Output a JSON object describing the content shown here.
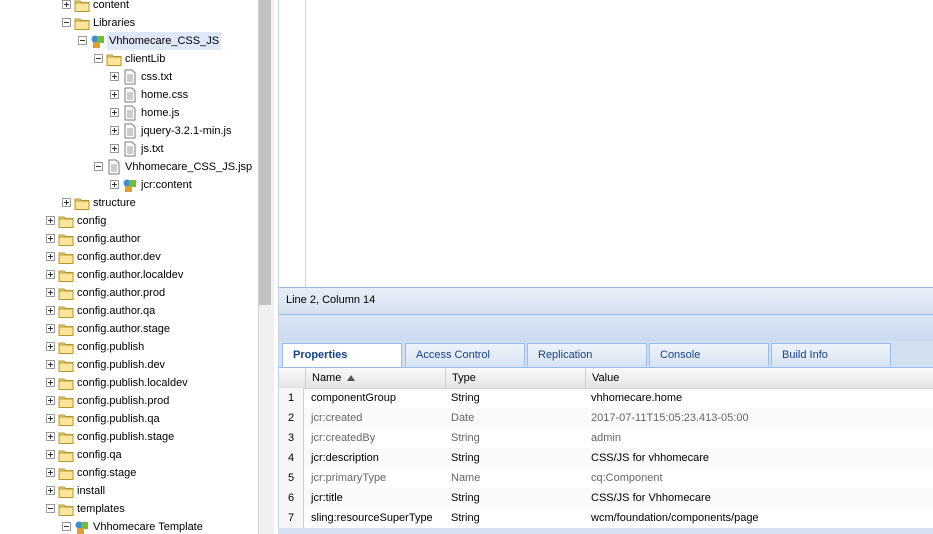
{
  "tree": {
    "nodes": [
      {
        "label": "content",
        "icon": "folder-icon",
        "expander": "plus"
      },
      {
        "label": "Libraries",
        "icon": "folder-icon",
        "expander": "minus"
      },
      {
        "label": "Vhhomecare_CSS_JS",
        "icon": "component-icon",
        "expander": "minus",
        "selected": true
      },
      {
        "label": "clientLib",
        "icon": "folder-icon",
        "expander": "minus"
      },
      {
        "label": "css.txt",
        "icon": "file-icon",
        "expander": "plus"
      },
      {
        "label": "home.css",
        "icon": "file-icon",
        "expander": "plus"
      },
      {
        "label": "home.js",
        "icon": "file-icon",
        "expander": "plus"
      },
      {
        "label": "jquery-3.2.1-min.js",
        "icon": "file-icon",
        "expander": "plus"
      },
      {
        "label": "js.txt",
        "icon": "file-icon",
        "expander": "plus"
      },
      {
        "label": "Vhhomecare_CSS_JS.jsp",
        "icon": "file-icon",
        "expander": "minus"
      },
      {
        "label": "jcr:content",
        "icon": "component-icon",
        "expander": "plus"
      },
      {
        "label": "structure",
        "icon": "folder-icon",
        "expander": "plus"
      },
      {
        "label": "config",
        "icon": "folder-icon",
        "expander": "plus"
      },
      {
        "label": "config.author",
        "icon": "folder-icon",
        "expander": "plus"
      },
      {
        "label": "config.author.dev",
        "icon": "folder-icon",
        "expander": "plus"
      },
      {
        "label": "config.author.localdev",
        "icon": "folder-icon",
        "expander": "plus"
      },
      {
        "label": "config.author.prod",
        "icon": "folder-icon",
        "expander": "plus"
      },
      {
        "label": "config.author.qa",
        "icon": "folder-icon",
        "expander": "plus"
      },
      {
        "label": "config.author.stage",
        "icon": "folder-icon",
        "expander": "plus"
      },
      {
        "label": "config.publish",
        "icon": "folder-icon",
        "expander": "plus"
      },
      {
        "label": "config.publish.dev",
        "icon": "folder-icon",
        "expander": "plus"
      },
      {
        "label": "config.publish.localdev",
        "icon": "folder-icon",
        "expander": "plus"
      },
      {
        "label": "config.publish.prod",
        "icon": "folder-icon",
        "expander": "plus"
      },
      {
        "label": "config.publish.qa",
        "icon": "folder-icon",
        "expander": "plus"
      },
      {
        "label": "config.publish.stage",
        "icon": "folder-icon",
        "expander": "plus"
      },
      {
        "label": "config.qa",
        "icon": "folder-icon",
        "expander": "plus"
      },
      {
        "label": "config.stage",
        "icon": "folder-icon",
        "expander": "plus"
      },
      {
        "label": "install",
        "icon": "folder-icon",
        "expander": "plus"
      },
      {
        "label": "templates",
        "icon": "folder-icon",
        "expander": "minus"
      },
      {
        "label": "Vhhomecare Template",
        "icon": "component-icon",
        "expander": "minus"
      }
    ]
  },
  "editor": {
    "status": "Line 2, Column 14"
  },
  "tabs": [
    {
      "label": "Properties",
      "active": true
    },
    {
      "label": "Access Control"
    },
    {
      "label": "Replication"
    },
    {
      "label": "Console"
    },
    {
      "label": "Build Info"
    }
  ],
  "grid": {
    "columns": {
      "name": "Name",
      "type": "Type",
      "value": "Value"
    },
    "sort_icon": "sort-ascending-icon",
    "rows": [
      {
        "num": "1",
        "name": "componentGroup",
        "type": "String",
        "value": "vhhomecare.home",
        "dim": false
      },
      {
        "num": "2",
        "name": "jcr:created",
        "type": "Date",
        "value": "2017-07-11T15:05:23.413-05:00",
        "dim": true
      },
      {
        "num": "3",
        "name": "jcr:createdBy",
        "type": "String",
        "value": "admin",
        "dim": true
      },
      {
        "num": "4",
        "name": "jcr:description",
        "type": "String",
        "value": "CSS/JS for vhhomecare",
        "dim": false
      },
      {
        "num": "5",
        "name": "jcr:primaryType",
        "type": "Name",
        "value": "cq:Component",
        "dim": true
      },
      {
        "num": "6",
        "name": "jcr:title",
        "type": "String",
        "value": "CSS/JS for Vhhomecare",
        "dim": false
      },
      {
        "num": "7",
        "name": "sling:resourceSuperType",
        "type": "String",
        "value": "wcm/foundation/components/page",
        "dim": false
      }
    ]
  },
  "colors": {
    "accent": "#15428b",
    "selection": "#dfe8f6",
    "border": "#99bbe8"
  }
}
